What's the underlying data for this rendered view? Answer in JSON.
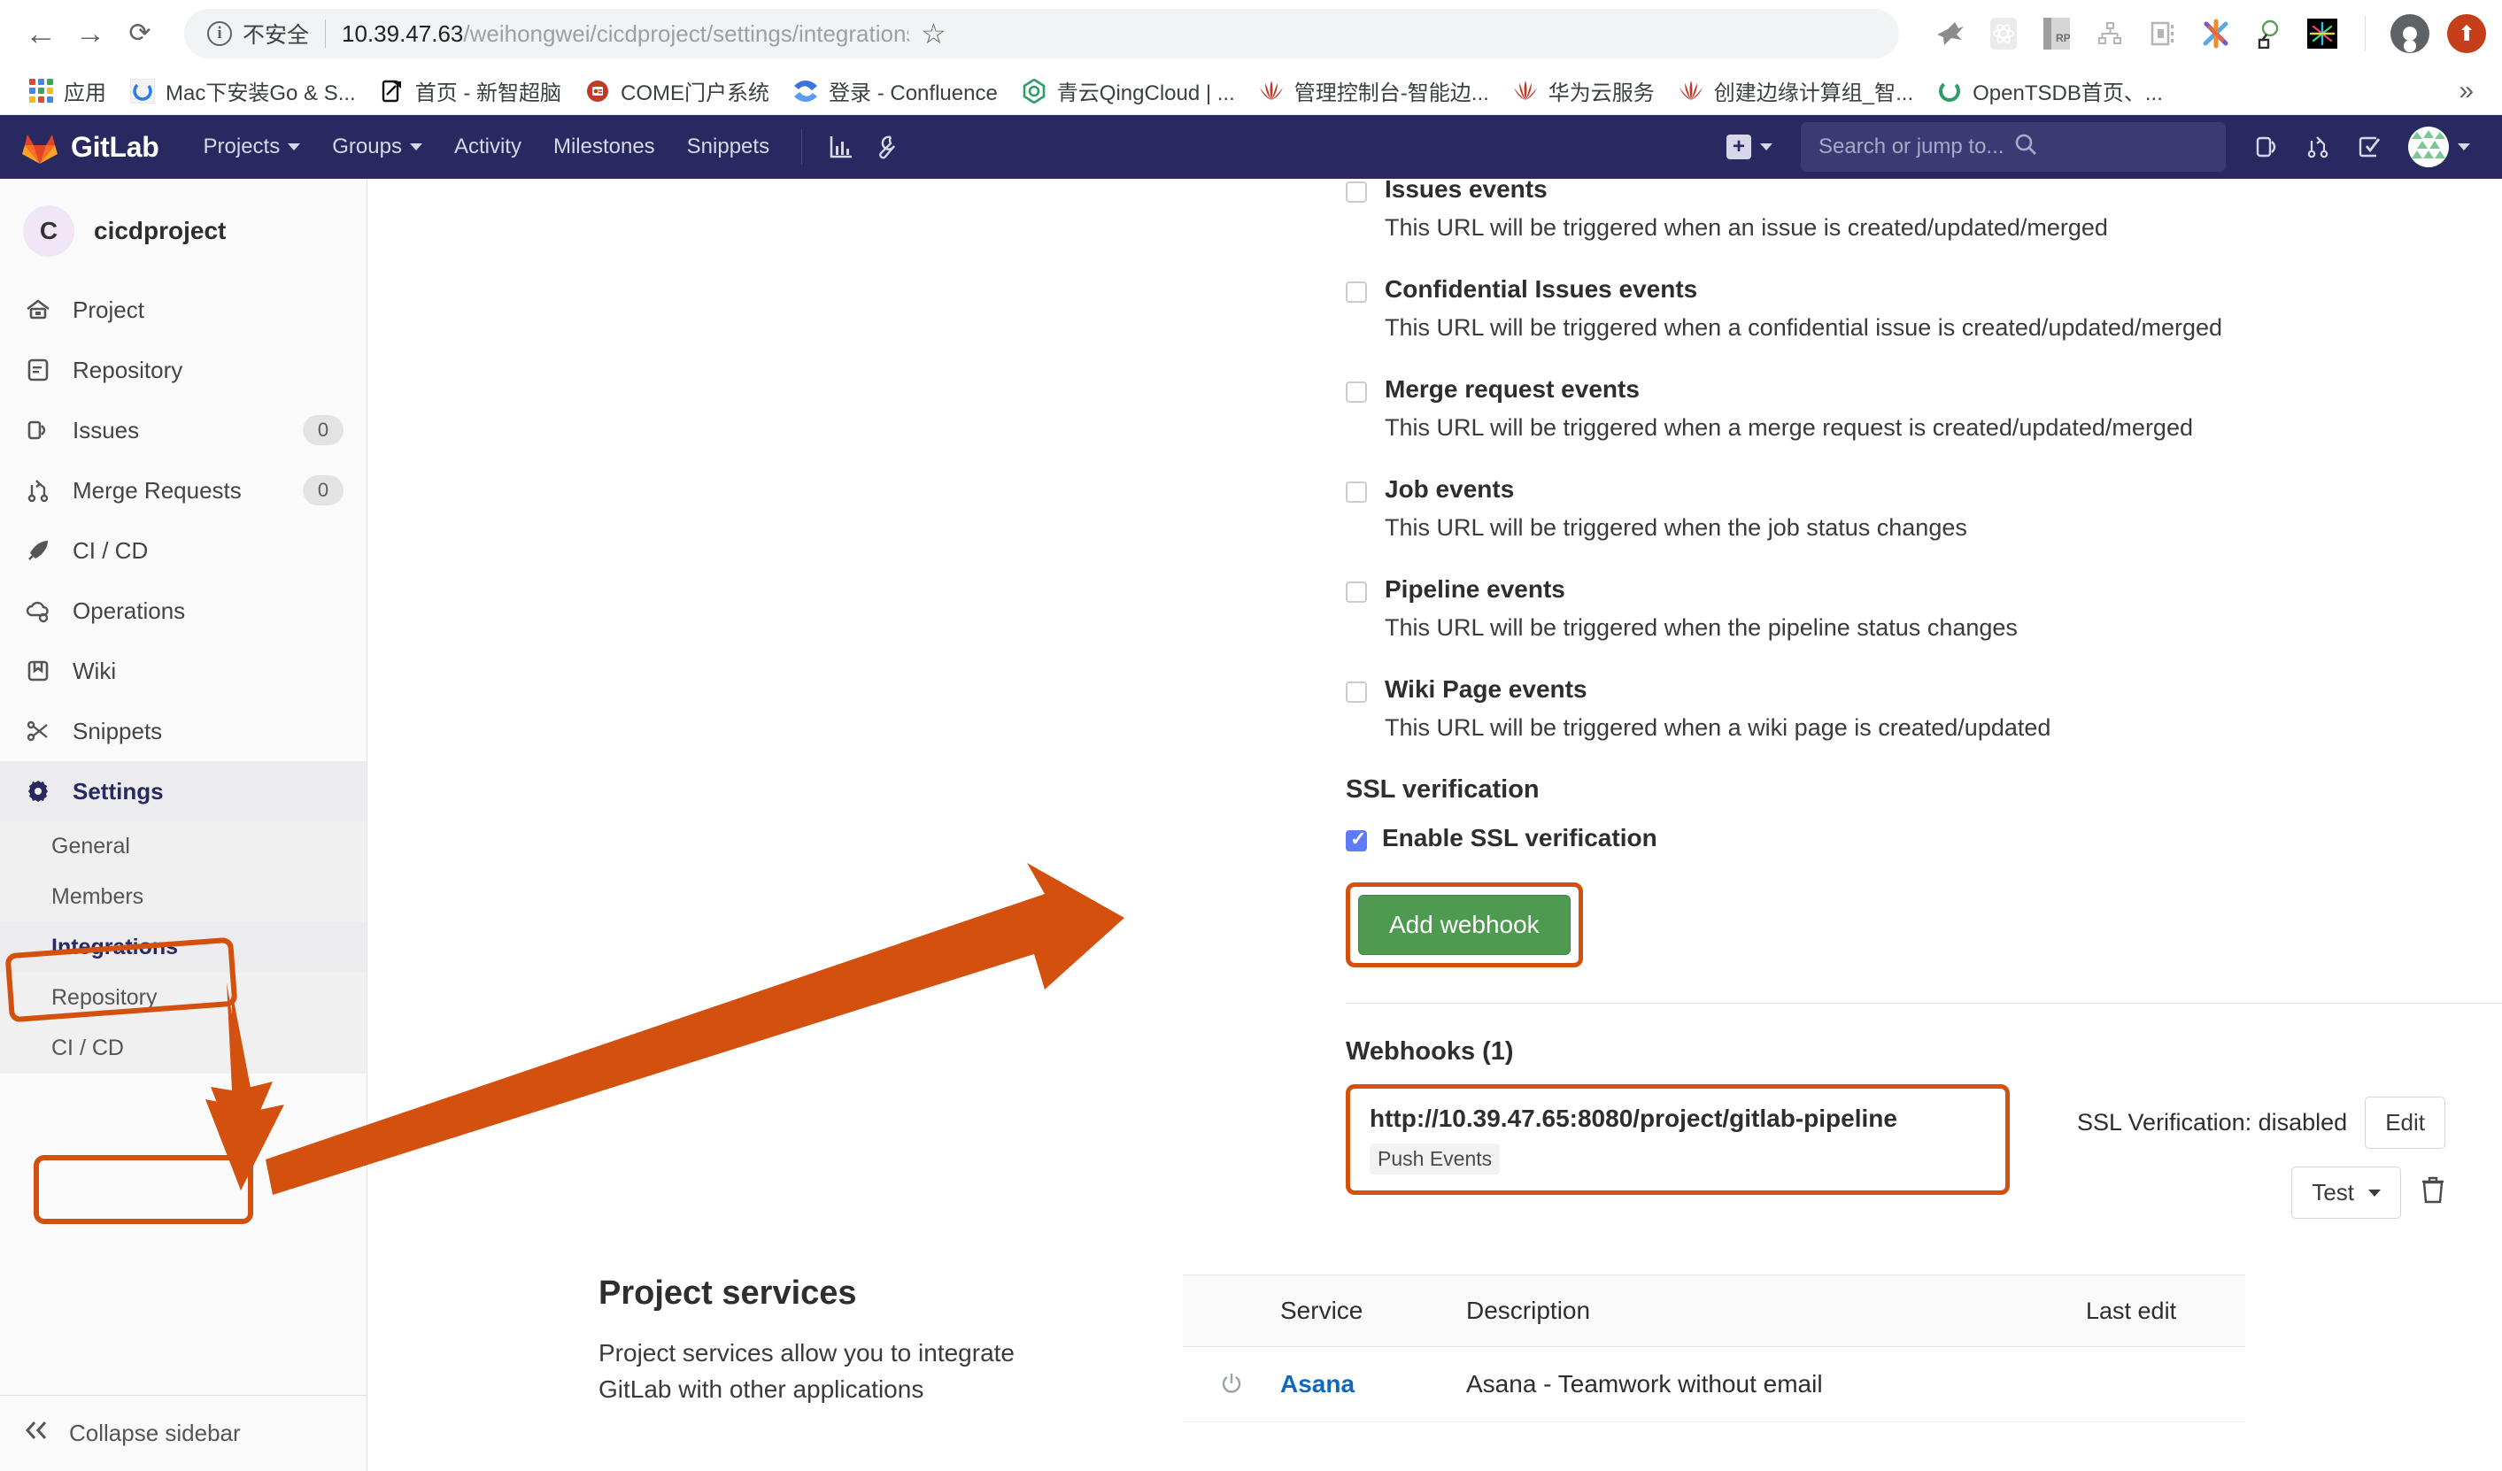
{
  "browser": {
    "nav": {
      "back": "←",
      "forward": "→",
      "reload": "⟳"
    },
    "security_label": "不安全",
    "url_host": "10.39.47.63",
    "url_path": "/weihongwei/cicdproject/settings/integrations",
    "star_icon": "☆",
    "bookmarks": [
      {
        "label": "应用",
        "icon": "apps-grid-icon"
      },
      {
        "label": "Mac下安装Go & S...",
        "icon": "chrome-circle-icon"
      },
      {
        "label": "首页 - 新智超脑",
        "icon": "note-edit-icon"
      },
      {
        "label": "COME门户系统",
        "icon": "come-portal-icon"
      },
      {
        "label": "登录 - Confluence",
        "icon": "confluence-icon"
      },
      {
        "label": "青云QingCloud | ...",
        "icon": "qingcloud-icon"
      },
      {
        "label": "管理控制台-智能边...",
        "icon": "huawei-icon"
      },
      {
        "label": "华为云服务",
        "icon": "huawei-icon"
      },
      {
        "label": "创建边缘计算组_智...",
        "icon": "huawei-icon"
      },
      {
        "label": "OpenTSDB首页、...",
        "icon": "chrome-circle-icon"
      }
    ],
    "overflow": "»"
  },
  "gitlab_nav": {
    "brand": "GitLab",
    "items": [
      {
        "label": "Projects",
        "has_caret": true
      },
      {
        "label": "Groups",
        "has_caret": true
      },
      {
        "label": "Activity",
        "has_caret": false
      },
      {
        "label": "Milestones",
        "has_caret": false
      },
      {
        "label": "Snippets",
        "has_caret": false
      }
    ],
    "icon_buttons": [
      "chart-icon",
      "wrench-icon"
    ],
    "search_placeholder": "Search or jump to...",
    "right_icons": [
      "issues-icon",
      "merge-requests-icon",
      "todos-icon"
    ],
    "plus_label": "+"
  },
  "sidebar": {
    "project_initial": "C",
    "project_name": "cicdproject",
    "items": [
      {
        "label": "Project",
        "icon": "home-icon",
        "badge": ""
      },
      {
        "label": "Repository",
        "icon": "document-icon",
        "badge": ""
      },
      {
        "label": "Issues",
        "icon": "issues-icon",
        "badge": "0"
      },
      {
        "label": "Merge Requests",
        "icon": "merge-icon",
        "badge": "0"
      },
      {
        "label": "CI / CD",
        "icon": "rocket-icon",
        "badge": ""
      },
      {
        "label": "Operations",
        "icon": "cloud-gear-icon",
        "badge": ""
      },
      {
        "label": "Wiki",
        "icon": "book-icon",
        "badge": ""
      },
      {
        "label": "Snippets",
        "icon": "scissors-icon",
        "badge": ""
      }
    ],
    "settings_label": "Settings",
    "settings_icon": "gear-icon",
    "sub_items": [
      {
        "label": "General",
        "current": false
      },
      {
        "label": "Members",
        "current": false
      },
      {
        "label": "Integrations",
        "current": true
      },
      {
        "label": "Repository",
        "current": false
      },
      {
        "label": "CI / CD",
        "current": false
      }
    ],
    "collapse_label": "Collapse sidebar",
    "collapse_icon": "double-chevron-left-icon"
  },
  "webhook_events": [
    {
      "title": "Issues events",
      "desc": "This URL will be triggered when an issue is created/updated/merged",
      "checked": false
    },
    {
      "title": "Confidential Issues events",
      "desc": "This URL will be triggered when a confidential issue is created/updated/merged",
      "checked": false
    },
    {
      "title": "Merge request events",
      "desc": "This URL will be triggered when a merge request is created/updated/merged",
      "checked": false
    },
    {
      "title": "Job events",
      "desc": "This URL will be triggered when the job status changes",
      "checked": false
    },
    {
      "title": "Pipeline events",
      "desc": "This URL will be triggered when the pipeline status changes",
      "checked": false
    },
    {
      "title": "Wiki Page events",
      "desc": "This URL will be triggered when a wiki page is created/updated",
      "checked": false
    }
  ],
  "ssl": {
    "section_title": "SSL verification",
    "enable_label": "Enable SSL verification",
    "enabled": true,
    "add_button": "Add webhook"
  },
  "webhooks": {
    "heading": "Webhooks (1)",
    "url": "http://10.39.47.65:8080/project/gitlab-pipeline",
    "tag": "Push Events",
    "ssl_status": "SSL Verification: disabled",
    "edit_label": "Edit",
    "test_label": "Test",
    "delete_icon": "trash-icon"
  },
  "project_services": {
    "heading": "Project services",
    "description": "Project services allow you to integrate GitLab with other applications",
    "columns": {
      "service": "Service",
      "description": "Description",
      "last_edit": "Last edit"
    },
    "rows": [
      {
        "icon": "power-icon",
        "service": "Asana",
        "description": "Asana - Teamwork without email",
        "last_edit": ""
      }
    ]
  },
  "colors": {
    "gitlab_navy": "#292961",
    "annotation_orange": "#d4500f",
    "button_green": "#4f9a51",
    "link_blue": "#1068bf",
    "checkbox_blue": "#5c7bf5"
  }
}
